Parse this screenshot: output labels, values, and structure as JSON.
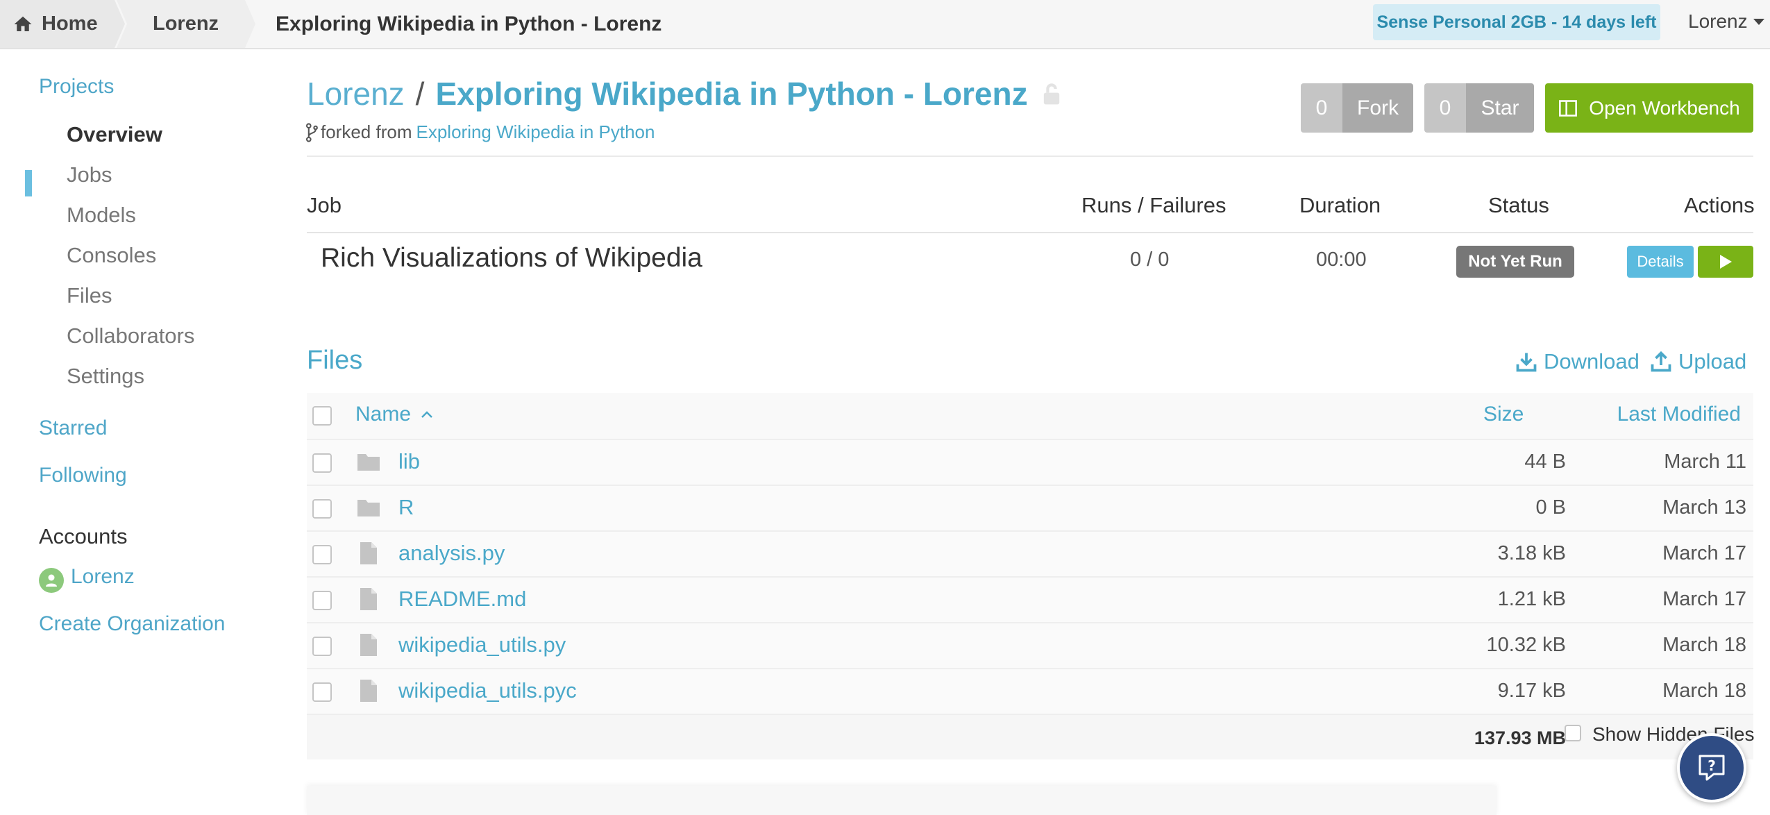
{
  "topbar": {
    "home_label": "Home",
    "user_crumb": "Lorenz",
    "project_crumb": "Exploring Wikipedia in Python - Lorenz",
    "trial_badge": "Sense Personal 2GB - 14 days left",
    "user_menu": "Lorenz"
  },
  "sidebar": {
    "projects": "Projects",
    "items": [
      {
        "label": "Overview",
        "active": true
      },
      {
        "label": "Jobs"
      },
      {
        "label": "Models"
      },
      {
        "label": "Consoles"
      },
      {
        "label": "Files"
      },
      {
        "label": "Collaborators"
      },
      {
        "label": "Settings"
      }
    ],
    "starred": "Starred",
    "following": "Following",
    "accounts_label": "Accounts",
    "account_name": "Lorenz",
    "create_org": "Create Organization"
  },
  "header": {
    "owner": "Lorenz",
    "separator": "/",
    "project_name": "Exploring Wikipedia in Python - Lorenz",
    "forked_prefix": "forked from",
    "forked_link": "Exploring Wikipedia in Python",
    "fork_count": "0",
    "fork_label": "Fork",
    "star_count": "0",
    "star_label": "Star",
    "workbench_label": "Open Workbench"
  },
  "jobs": {
    "headers": {
      "job": "Job",
      "runs": "Runs / Failures",
      "duration": "Duration",
      "status": "Status",
      "actions": "Actions"
    },
    "rows": [
      {
        "name": "Rich Visualizations of Wikipedia",
        "runs": "0 / 0",
        "duration": "00:00",
        "status": "Not Yet Run",
        "details_label": "Details"
      }
    ]
  },
  "files": {
    "title": "Files",
    "download": "Download",
    "upload": "Upload",
    "headers": {
      "name": "Name",
      "size": "Size",
      "modified": "Last Modified"
    },
    "rows": [
      {
        "icon": "folder-icon",
        "name": "lib",
        "size": "44 B",
        "modified": "March 11"
      },
      {
        "icon": "folder-icon",
        "name": "R",
        "size": "0 B",
        "modified": "March 13"
      },
      {
        "icon": "file-icon",
        "name": "analysis.py",
        "size": "3.18 kB",
        "modified": "March 17"
      },
      {
        "icon": "file-icon",
        "name": "README.md",
        "size": "1.21 kB",
        "modified": "March 17"
      },
      {
        "icon": "file-icon",
        "name": "wikipedia_utils.py",
        "size": "10.32 kB",
        "modified": "March 18"
      },
      {
        "icon": "file-icon",
        "name": "wikipedia_utils.pyc",
        "size": "9.17 kB",
        "modified": "March 18"
      }
    ],
    "total_size": "137.93 MB",
    "show_hidden_label": "Show Hidden Files"
  },
  "colors": {
    "accent": "#4aa8c9",
    "green": "#7ab317",
    "status_gray": "#777777",
    "help_button": "#2f4c84"
  }
}
